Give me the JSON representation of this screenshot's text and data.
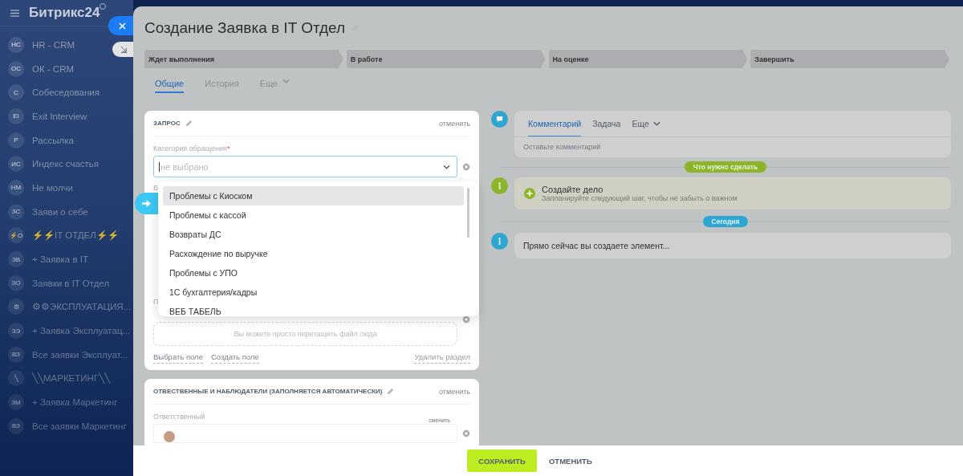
{
  "sidebar": {
    "logo": "Битрикс24",
    "items": [
      {
        "initials": "НС",
        "label": "HR - CRM"
      },
      {
        "initials": "ОС",
        "label": "ОК - CRM"
      },
      {
        "initials": "С",
        "label": "Собеседования"
      },
      {
        "initials": "EI",
        "label": "Exit Interview"
      },
      {
        "initials": "Р",
        "label": "Рассылка"
      },
      {
        "initials": "ИС",
        "label": "Индекс счастья"
      },
      {
        "initials": "НМ",
        "label": "Не молчи"
      },
      {
        "initials": "ЗС",
        "label": "Заяви о себе"
      },
      {
        "initials": "⚡О",
        "label": "⚡⚡IT ОТДЕЛ⚡⚡"
      },
      {
        "initials": "ЗВ",
        "label": "+ Заявка в IT"
      },
      {
        "initials": "ЗО",
        "label": "Заявки в IT Отдел"
      },
      {
        "initials": "⚙",
        "label": "⚙⚙ЭКСПЛУАТАЦИЯ..."
      },
      {
        "initials": "ЗЭ",
        "label": "+ Заявка Эксплуатац..."
      },
      {
        "initials": "ВЗ",
        "label": "Все заявки Эксплуат..."
      },
      {
        "initials": "╲",
        "label": "╲╲МАРКЕТИНГ╲╲"
      },
      {
        "initials": "ЗМ",
        "label": "+ Заявка Маркетинг"
      },
      {
        "initials": "ВЗ",
        "label": "Все заявки Маркетинг"
      }
    ]
  },
  "slider": {
    "title": "Создание Заявка в IT Отдел",
    "stages": [
      {
        "label": "Ждет выполнения"
      },
      {
        "label": "В работе"
      },
      {
        "label": "На оценке"
      },
      {
        "label": "Завершить"
      }
    ],
    "tabs": [
      {
        "label": "Общие",
        "selected": true
      },
      {
        "label": "История",
        "selected": false
      },
      {
        "label": "Еще",
        "selected": false
      }
    ],
    "request_card": {
      "title": "ЗАПРОС",
      "cancel": "отменить",
      "field_label": "Категория обращения",
      "required_mark": "*",
      "select": {
        "placeholder": "не выбрано"
      },
      "partial_label_1": "В",
      "partial_label_2": "П",
      "dropzone": "Вы можете просто перетащить файл сюда",
      "links": [
        "Выбрать поле",
        "Создать поле"
      ],
      "delete": "Удалить раздел"
    },
    "dropdown": {
      "options": [
        {
          "label": "Проблемы с Киоском",
          "selected": true
        },
        {
          "label": "Проблемы с кассой",
          "selected": false
        },
        {
          "label": "Возвраты ДС",
          "selected": false
        },
        {
          "label": "Расхождение по выручке",
          "selected": false
        },
        {
          "label": "Проблемы с УПО",
          "selected": false
        },
        {
          "label": "1С бухгалтерия/кадры",
          "selected": false
        },
        {
          "label": "ВЕБ ТАБЕЛЬ",
          "selected": false
        }
      ]
    },
    "responsible_card": {
      "title": "ОТВЕСТВЕННЫЕ И НАБЛЮДАТЕЛИ (ЗАПОЛНЯЕТСЯ АВТОМАТИЧЕСКИ)",
      "cancel": "отменить",
      "field_label": "Ответственный",
      "change": "сменить"
    },
    "timeline": {
      "composer": {
        "tabs": [
          {
            "label": "Комментарий",
            "selected": true
          },
          {
            "label": "Задача",
            "selected": false
          },
          {
            "label": "Еще",
            "selected": false
          }
        ],
        "placeholder": "Оставьте комментарий"
      },
      "todo_badge": "Что нужно сделать",
      "todo": {
        "title": "Создайте дело",
        "hint": "Запланируйте следующий шаг, чтобы не забыть о важном"
      },
      "today_badge": "Сегодня",
      "info": "Прямо сейчас вы создаете элемент..."
    },
    "footer": {
      "save": "СОХРАНИТЬ",
      "cancel": "ОТМЕНИТЬ"
    }
  }
}
